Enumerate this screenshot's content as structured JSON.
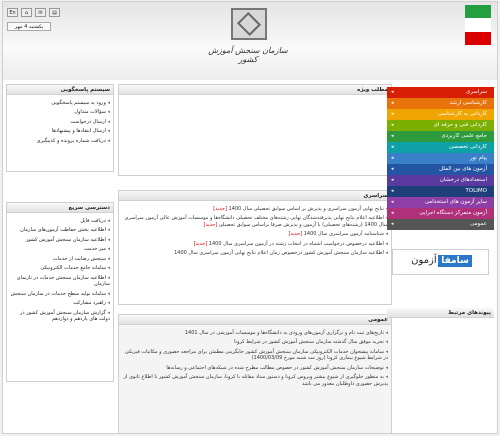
{
  "header": {
    "org_name": "سازمان سنجش آموزش کشور",
    "date": "یکشنبه 4 مهر",
    "tools": [
      "En",
      "⌂",
      "✉",
      "▤"
    ]
  },
  "left": {
    "system_title": "سیستم پاسخگویی",
    "system_items": [
      "ورود به سیستم پاسخگویی",
      "سؤالات متداول",
      "ارسال درخواست",
      "ارسال انتقادها و پیشنهادها",
      "دریافت شماره پرونده و کدپیگیری"
    ],
    "quick_title": "دسترسی سریع",
    "quick_items": [
      "دریافت فایل",
      "اطلاعیه بخش حفاظت آزمون‌های سازمان",
      "اطلاعیه سازمان سنجش آموزش کشور",
      "میز خدمت",
      "سنجش رضایت از خدمات",
      "سامانه جامع خدمات الکترونیکی",
      "اطلاعیه سازمان سنجش خدمات در تارنمای سازمان",
      "سامانه تولید سطح خدمات در سازمان سنجش",
      "راهبرد مشارکت",
      "گزارش سازمان سنجش آموزش کشور در دولت های یازدهم و دوازدهم"
    ]
  },
  "center": {
    "featured_title": "مطلب ویژه",
    "sarasari_title": "سراسری",
    "sarasari_items": [
      {
        "text": "نتایج نهایی آزمون سراسری و پذیرش بر اساس سوابق تحصیلی سال 1400",
        "hot": "[جدید]"
      },
      {
        "text": "اطلاعیه اعلام نتایج نهایی پذیرفته‌شدگان نهایی رشته‌های مختلف تحصیلی دانشگاه‌ها و موسسات آموزش عالی آزمون سراسری سال 1400 (رشته‌های تحصیلی) با آزمون و پذیرش صرفا براساس سوابق تحصیلی",
        "hot": "[جدید]"
      },
      {
        "text": "شناسنامه آزمون سراسری سال 1400",
        "hot": "[جدید]"
      },
      {
        "text": "اطلاعیه درخصوص درخواست اشتباه در انتخاب رشته در آزمون سراسری سال 1400",
        "hot": "[جدید]"
      },
      {
        "text": "اطلاعیه سازمان سنجش آموزش کشور درخصوص زمان اعلام نتایج نهایی آزمون سراسری سال 1400",
        "hot": ""
      }
    ],
    "general_title": "عمومی",
    "general_items": [
      {
        "text": "تاریخ‌های ثبت نام و برگزاری آزمون‌های ورودی به دانشگاه‌ها و موسسات آموزشی در سال 1401",
        "hot": ""
      },
      {
        "text": "تجربه موفق سال گذشته سازمان سنجش آموزش کشور در شرایط کرونا",
        "hot": ""
      },
      {
        "text": "سامانه پیشخوان خدمات الکترونیکی سازمان سنجش آموزش کشور جایگزینی مطمئن برای مراجعه حضوری و مکاتبات فیزیکی در شرایط شیوع بیماری کرونا (روز سه شنبه مورخ 1400/03/09)",
        "hot": ""
      },
      {
        "text": "توضیحات سازمان سنجش آموزش کشور در خصوص مطالب مطرح شده در شبکه‌های اجتماعی و رسانه‌ها",
        "hot": ""
      },
      {
        "text": "به منظور جلوگیری از شیوع بیشتر ویروس کرونا و دستور ستاد مقابله با کرونا، سازمان سنجش آموزش کشور تا اطلاع ثانوی از پذیرش حضوری داوطلبان معذور می باشد",
        "hot": ""
      }
    ]
  },
  "right": {
    "menu": [
      {
        "label": "سراسری",
        "color": "#d81e05"
      },
      {
        "label": "کارشناسی ارشد",
        "color": "#e8730c"
      },
      {
        "label": "کاردانی به کارشناسی",
        "color": "#f0a500"
      },
      {
        "label": "کاردانی فنی و حرفه ای",
        "color": "#7cb000"
      },
      {
        "label": "جامع علمی کاربردی",
        "color": "#2e9a3e"
      },
      {
        "label": "کاردانی تخصصی",
        "color": "#0ea2a8"
      },
      {
        "label": "پیام نور",
        "color": "#3a80c8"
      },
      {
        "label": "آزمون های بین الملل",
        "color": "#2455a4"
      },
      {
        "label": "استعدادهای درخشان",
        "color": "#5a3a9e"
      },
      {
        "label": "TOLIMO",
        "color": "#1f3f7a"
      },
      {
        "label": "سایر آزمون های استخدامی",
        "color": "#8e3fa6"
      },
      {
        "label": "آزمون متمرکز دستگاه اجرایی",
        "color": "#b0307a"
      },
      {
        "label": "عمومی",
        "color": "#555555"
      }
    ],
    "saamfa_text": "سامفا",
    "saamfa_prefix": "آزمون",
    "links_title": "پیوندهای مرتبط"
  }
}
